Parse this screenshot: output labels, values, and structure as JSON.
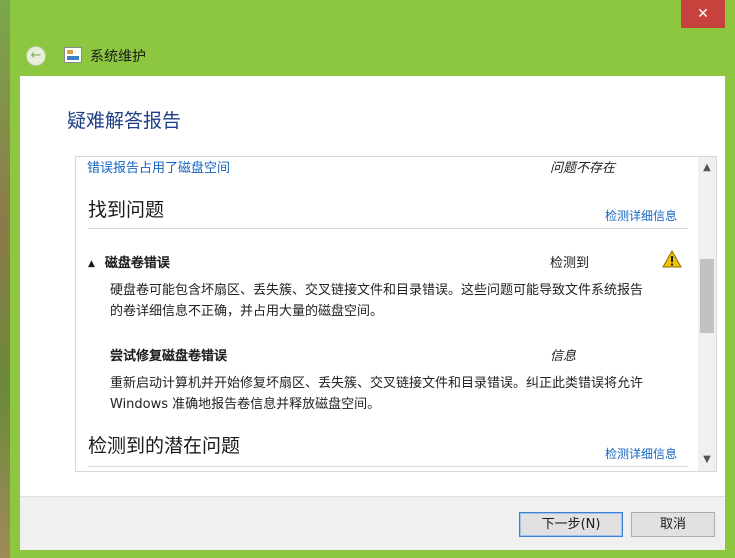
{
  "window": {
    "close_glyph": "✕"
  },
  "nav": {
    "back_glyph": "←",
    "title": "系统维护"
  },
  "page": {
    "heading": "疑难解答报告"
  },
  "report": {
    "top_row": {
      "link": "错误报告占用了磁盘空间",
      "status": "问题不存在"
    },
    "found": {
      "title": "找到问题",
      "detail_link": "检测详细信息",
      "problem": {
        "title": "磁盘卷错误",
        "status": "检测到",
        "description": "硬盘卷可能包含坏扇区、丢失簇、交叉链接文件和目录错误。这些问题可能导致文件系统报告的卷详细信息不正确，并占用大量的磁盘空间。",
        "fix_title": "尝试修复磁盘卷错误",
        "fix_status": "信息",
        "fix_description": "重新启动计算机并开始修复坏扇区、丢失簇、交叉链接文件和目录错误。纠正此类错误将允许 Windows 准确地报告卷信息并释放磁盘空间。"
      }
    },
    "potential": {
      "title": "检测到的潜在问题",
      "detail_link": "检测详细信息"
    },
    "scroll_up": "▲",
    "scroll_down": "▼"
  },
  "footer": {
    "next_label": "下一步(N)",
    "cancel_label": "取消"
  },
  "colors": {
    "window_frame": "#8dc63f",
    "close": "#c7413d",
    "heading": "#1e3f87",
    "link": "#1565c0",
    "warning": "#f2c200"
  },
  "icons": {
    "warning": "warning-icon",
    "collapse": "collapse-triangle-icon",
    "app": "system-maintenance-icon"
  }
}
